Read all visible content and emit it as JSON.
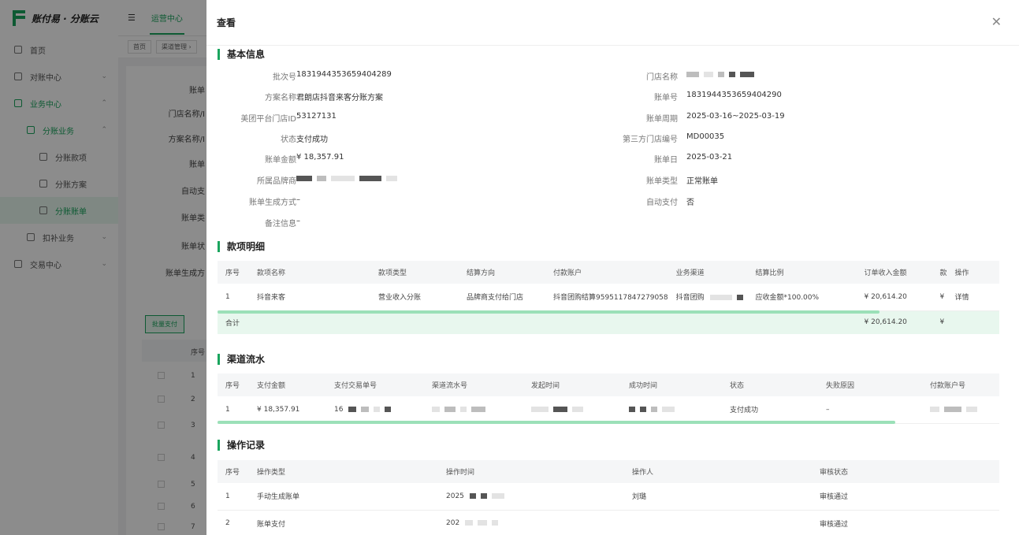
{
  "app": {
    "logo": "账付易 · 分账云",
    "menu": [
      {
        "label": "首页"
      },
      {
        "label": "对账中心"
      },
      {
        "label": "业务中心"
      },
      {
        "label": "分账业务"
      },
      {
        "label": "分账款项"
      },
      {
        "label": "分账方案"
      },
      {
        "label": "分账账单"
      },
      {
        "label": "扣补业务"
      },
      {
        "label": "交易中心"
      }
    ],
    "top_tab": "运营中心",
    "crumbs": [
      "首页",
      "渠道管理 ›"
    ],
    "filter_labels": [
      "账单",
      "门店名称/I",
      "方案名称/I",
      "账单",
      "自动支",
      "账单类",
      "账单状",
      "账单生成方"
    ],
    "bulk_button": "批量支付",
    "bg_table_head": "序号",
    "bg_rows": [
      "1",
      "2",
      "3",
      "4",
      "5",
      "6",
      "7"
    ]
  },
  "drawer": {
    "title": "查看",
    "close_icon": "close-icon",
    "basic": {
      "title": "基本信息",
      "left": [
        {
          "label": "批次号",
          "value": "1831944353659404289"
        },
        {
          "label": "方案名称",
          "value": "君朗店抖音来客分账方案"
        },
        {
          "label": "美团平台门店ID",
          "value": "53127131"
        },
        {
          "label": "状态",
          "value": "支付成功"
        },
        {
          "label": "账单金额",
          "value": "¥ 18,357.91"
        },
        {
          "label": "所属品牌商",
          "value": ""
        },
        {
          "label": "账单生成方式",
          "value": "–"
        },
        {
          "label": "备注信息",
          "value": "–"
        }
      ],
      "right": [
        {
          "label": "门店名称",
          "value": ""
        },
        {
          "label": "账单号",
          "value": "1831944353659404290"
        },
        {
          "label": "账单周期",
          "value": "2025-03-16~2025-03-19"
        },
        {
          "label": "第三方门店编号",
          "value": "MD00035"
        },
        {
          "label": "账单日",
          "value": "2025-03-21"
        },
        {
          "label": "账单类型",
          "value": "正常账单"
        },
        {
          "label": "自动支付",
          "value": "否"
        }
      ]
    },
    "items": {
      "title": "款项明细",
      "headers": [
        "序号",
        "款项名称",
        "款项类型",
        "结算方向",
        "付款账户",
        "业务渠道",
        "结算比例",
        "订单收入金额",
        "款",
        "操作"
      ],
      "rows": [
        [
          "1",
          "抖音来客",
          "营业收入分账",
          "品牌商支付给门店",
          "抖音团购结算9595117847279058",
          "抖音团购",
          "应收金额*100.00%",
          "¥ 20,614.20",
          "¥",
          "详情"
        ]
      ],
      "total_label": "合计",
      "total_amount": "¥ 20,614.20",
      "total_extra": "¥"
    },
    "flow": {
      "title": "渠道流水",
      "headers": [
        "序号",
        "支付金额",
        "支付交易单号",
        "渠道流水号",
        "发起时间",
        "成功时间",
        "状态",
        "失败原因",
        "付款账户号"
      ],
      "rows": [
        [
          "1",
          "¥ 18,357.91",
          "16",
          "",
          "",
          "",
          "支付成功",
          "–",
          ""
        ]
      ]
    },
    "log": {
      "title": "操作记录",
      "headers": [
        "序号",
        "操作类型",
        "操作时间",
        "操作人",
        "审核状态"
      ],
      "rows": [
        [
          "1",
          "手动生成账单",
          "2025",
          "刘璐",
          "审核通过"
        ],
        [
          "2",
          "账单支付",
          "202",
          "",
          "审核通过"
        ]
      ]
    },
    "colors": {
      "accent": "#1aa55e",
      "accent_light": "#e8f7ee"
    }
  }
}
